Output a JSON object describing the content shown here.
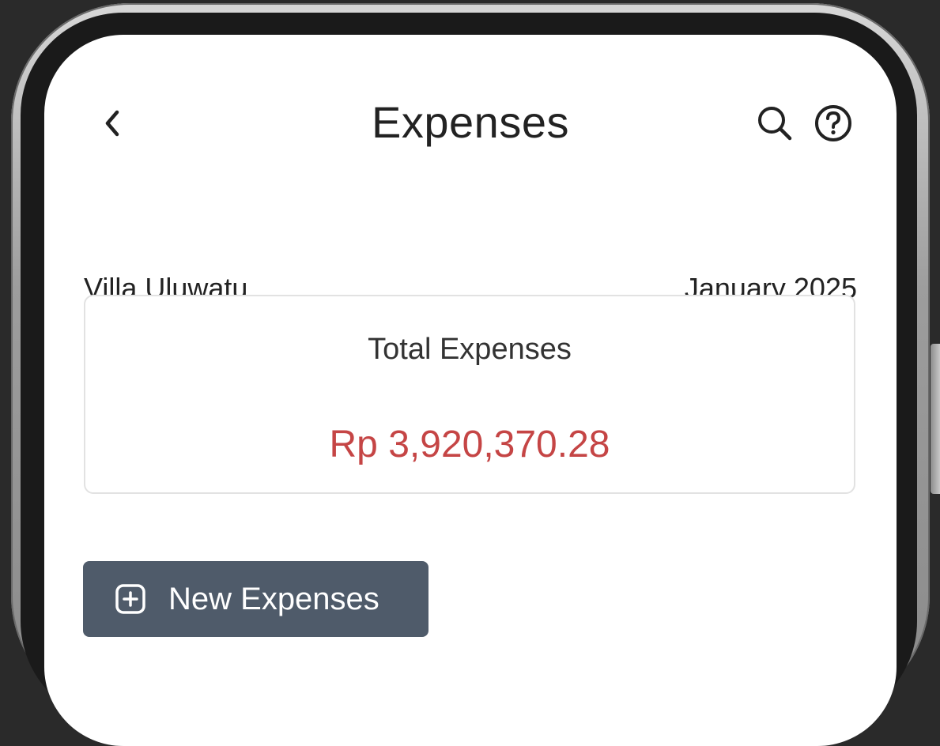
{
  "header": {
    "title": "Expenses",
    "back_icon": "chevron-left-icon",
    "search_icon": "search-icon",
    "help_icon": "help-circle-icon"
  },
  "info": {
    "property_name": "Villa Uluwatu",
    "period": "January 2025"
  },
  "summary": {
    "label": "Total Expenses",
    "amount": "Rp 3,920,370.28",
    "amount_color": "#c54545"
  },
  "actions": {
    "new_expense_label": "New Expenses",
    "new_expense_icon": "plus-square-icon",
    "button_color": "#4f5b6a"
  }
}
